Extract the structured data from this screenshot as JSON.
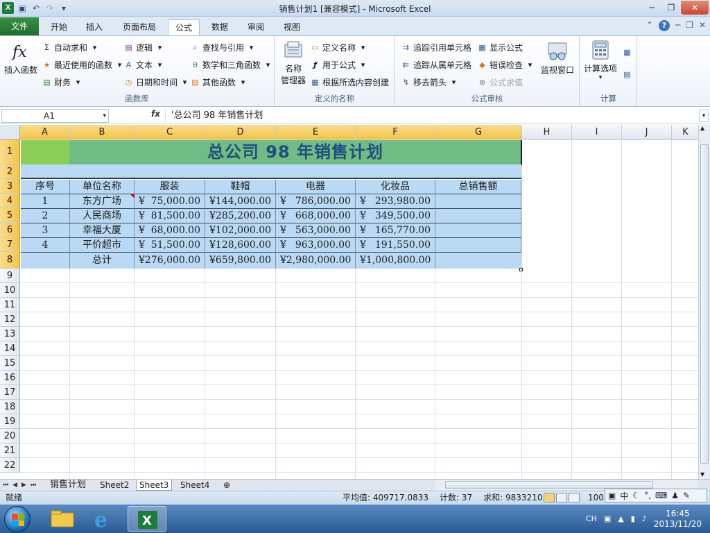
{
  "window": {
    "app_icon": "X",
    "title": "销售计划1  [兼容模式] - Microsoft Excel"
  },
  "tabs": {
    "file": "文件",
    "items": [
      "开始",
      "插入",
      "页面布局",
      "公式",
      "数据",
      "审阅",
      "视图"
    ],
    "active": "公式"
  },
  "ribbon": {
    "function_library": {
      "insert_function": "插入函数",
      "autosum": "自动求和",
      "recent": "最近使用的函数",
      "financial": "财务",
      "logical": "逻辑",
      "text": "文本",
      "datetime": "日期和时间",
      "lookup": "查找与引用",
      "math": "数学和三角函数",
      "more": "其他函数",
      "label": "函数库"
    },
    "defined_names": {
      "name_manager_1": "名称",
      "name_manager_2": "管理器",
      "define_name": "定义名称",
      "use_in_formula": "用于公式",
      "create_from_selection": "根据所选内容创建",
      "label": "定义的名称"
    },
    "formula_auditing": {
      "trace_precedents": "追踪引用单元格",
      "trace_dependents": "追踪从属单元格",
      "remove_arrows": "移去箭头",
      "show_formulas": "显示公式",
      "error_checking": "错误检查",
      "evaluate": "公式求值",
      "watch_window": "监视窗口",
      "label": "公式审核"
    },
    "calculation": {
      "options": "计算选项",
      "label": "计算"
    }
  },
  "formula_bar": {
    "name_box": "A1",
    "fx": "fx",
    "content": "'总公司 98 年销售计划"
  },
  "columns": [
    "A",
    "B",
    "C",
    "D",
    "E",
    "F",
    "G",
    "H",
    "I",
    "J",
    "K"
  ],
  "rows": [
    "1",
    "2",
    "3",
    "4",
    "5",
    "6",
    "7",
    "8",
    "9",
    "10",
    "11",
    "12",
    "13",
    "14",
    "15",
    "16",
    "17",
    "18",
    "19",
    "20",
    "21",
    "22"
  ],
  "sheet": {
    "title": "总公司 98 年销售计划",
    "headers": [
      "序号",
      "单位名称",
      "服装",
      "鞋帽",
      "电器",
      "化妆品",
      "总销售额"
    ],
    "currency_symbol": "¥",
    "data_rows": [
      [
        "1",
        "东方广场",
        "75,000.00",
        "144,000.00",
        "786,000.00",
        "293,980.00"
      ],
      [
        "2",
        "人民商场",
        "81,500.00",
        "285,200.00",
        "668,000.00",
        "349,500.00"
      ],
      [
        "3",
        "幸福大厦",
        "68,000.00",
        "102,000.00",
        "563,000.00",
        "165,770.00"
      ],
      [
        "4",
        "平价超市",
        "51,500.00",
        "128,600.00",
        "963,000.00",
        "191,550.00"
      ]
    ],
    "total_label": "总计",
    "totals": [
      "276,000.00",
      "659,800.00",
      "2,980,000.00",
      "1,000,800.00"
    ]
  },
  "sheet_tabs": [
    "销售计划",
    "Sheet2",
    "Sheet3",
    "Sheet4"
  ],
  "active_sheet": "Sheet3",
  "status": {
    "ready": "就绪",
    "average": "平均值: 409717.0833",
    "count": "计数: 37",
    "sum": "求和: 9833210",
    "zoom": "100"
  },
  "ime": {
    "mode": "中"
  },
  "taskbar": {
    "lang": "CH",
    "time": "16:45",
    "date": "2013/11/20"
  }
}
